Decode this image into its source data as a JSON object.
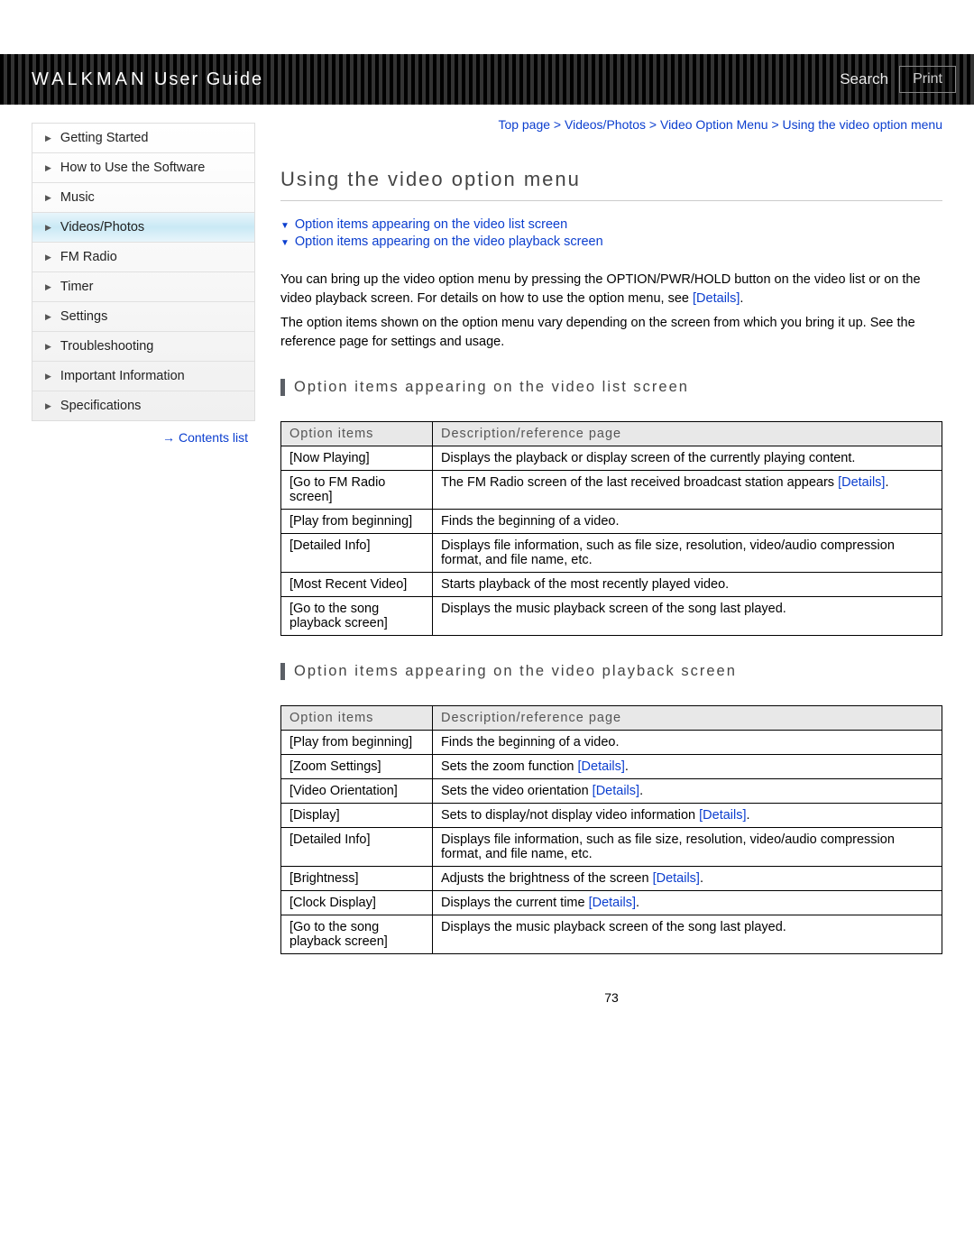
{
  "header": {
    "title_prefix": "WALKMAN",
    "title_suffix": " User Guide",
    "search": "Search",
    "print": "Print"
  },
  "sidebar": {
    "items": [
      "Getting Started",
      "How to Use the Software",
      "Music",
      "Videos/Photos",
      "FM Radio",
      "Timer",
      "Settings",
      "Troubleshooting",
      "Important Information",
      "Specifications"
    ],
    "active_index": 3,
    "contents_link": "Contents list"
  },
  "breadcrumb": "Top page > Videos/Photos > Video Option Menu > Using the video option menu",
  "page_title": "Using the video option menu",
  "anchors": [
    "Option items appearing on the video list screen",
    "Option items appearing on the video playback screen"
  ],
  "intro": {
    "p1": "You can bring up the video option menu by pressing the OPTION/PWR/HOLD button on the video list or on the video playback screen. For details on how to use the option menu, see ",
    "details": "[Details]",
    "p1_end": ".",
    "p2": "The option items shown on the option menu vary depending on the screen from which you bring it up. See the reference page for settings and usage."
  },
  "section1": {
    "heading": "Option items appearing on the video list screen",
    "th1": "Option items",
    "th2": "Description/reference page",
    "rows": [
      {
        "item": "[Now Playing]",
        "desc_pre": "Displays the playback or display screen of the currently playing content.",
        "link": "",
        "desc_post": ""
      },
      {
        "item": "[Go to FM Radio screen]",
        "desc_pre": "The FM Radio screen of the last received broadcast station appears ",
        "link": "[Details]",
        "desc_post": "."
      },
      {
        "item": "[Play from beginning]",
        "desc_pre": "Finds the beginning of a video.",
        "link": "",
        "desc_post": ""
      },
      {
        "item": "[Detailed Info]",
        "desc_pre": "Displays file information, such as file size, resolution, video/audio compression format, and file name, etc.",
        "link": "",
        "desc_post": ""
      },
      {
        "item": "[Most Recent Video]",
        "desc_pre": "Starts playback of the most recently played video.",
        "link": "",
        "desc_post": ""
      },
      {
        "item": "[Go to the song playback screen]",
        "desc_pre": "Displays the music playback screen of the song last played.",
        "link": "",
        "desc_post": ""
      }
    ]
  },
  "section2": {
    "heading": "Option items appearing on the video playback screen",
    "th1": "Option items",
    "th2": "Description/reference page",
    "rows": [
      {
        "item": "[Play from beginning]",
        "desc_pre": "Finds the beginning of a video.",
        "link": "",
        "desc_post": ""
      },
      {
        "item": "[Zoom Settings]",
        "desc_pre": "Sets the zoom function ",
        "link": "[Details]",
        "desc_post": "."
      },
      {
        "item": "[Video Orientation]",
        "desc_pre": "Sets the video orientation ",
        "link": "[Details]",
        "desc_post": "."
      },
      {
        "item": "[Display]",
        "desc_pre": "Sets to display/not display video information ",
        "link": "[Details]",
        "desc_post": "."
      },
      {
        "item": "[Detailed Info]",
        "desc_pre": "Displays file information, such as file size, resolution, video/audio compression format, and file name, etc.",
        "link": "",
        "desc_post": ""
      },
      {
        "item": "[Brightness]",
        "desc_pre": "Adjusts the brightness of the screen ",
        "link": "[Details]",
        "desc_post": "."
      },
      {
        "item": "[Clock Display]",
        "desc_pre": "Displays the current time ",
        "link": "[Details]",
        "desc_post": "."
      },
      {
        "item": "[Go to the song playback screen]",
        "desc_pre": "Displays the music playback screen of the song last played.",
        "link": "",
        "desc_post": ""
      }
    ]
  },
  "page_number": "73"
}
